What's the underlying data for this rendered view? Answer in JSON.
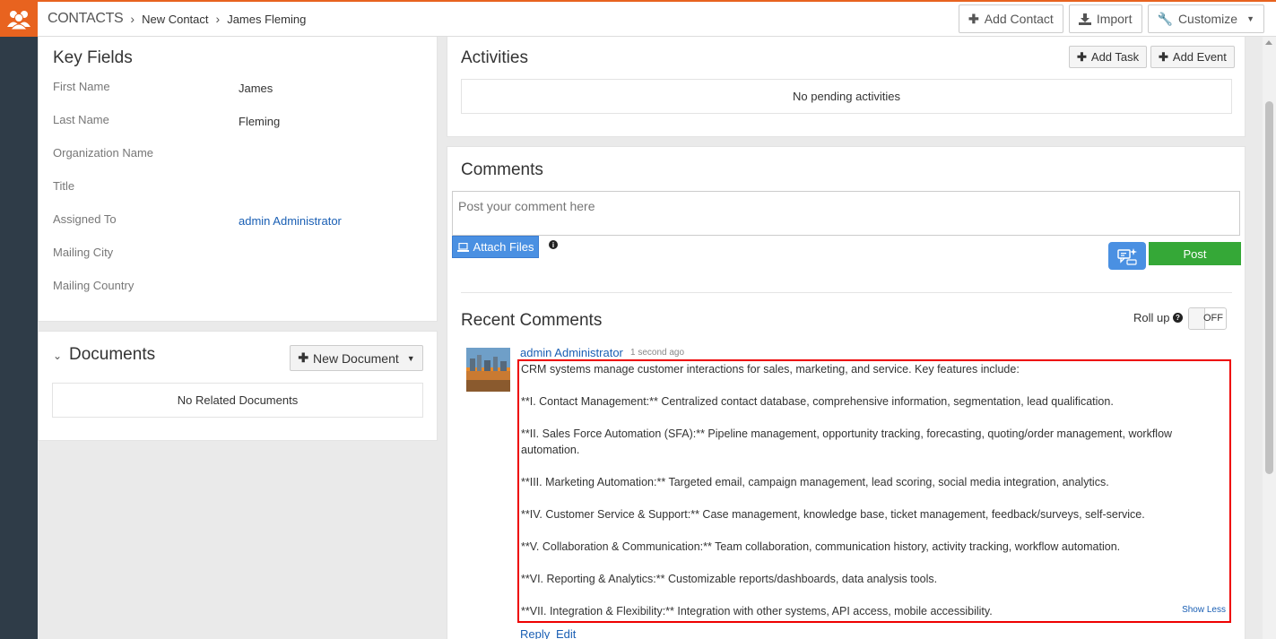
{
  "header": {
    "module": "CONTACTS",
    "breadcrumb_mid": "New Contact",
    "breadcrumb_current": "James Fleming",
    "add_contact_label": "Add Contact",
    "import_label": "Import",
    "customize_label": "Customize"
  },
  "key_fields": {
    "title": "Key Fields",
    "fields": [
      {
        "label": "First Name",
        "value": "James"
      },
      {
        "label": "Last Name",
        "value": "Fleming"
      },
      {
        "label": "Organization Name",
        "value": ""
      },
      {
        "label": "Title",
        "value": ""
      },
      {
        "label": "Assigned To",
        "value": "admin Administrator"
      },
      {
        "label": "Mailing City",
        "value": ""
      },
      {
        "label": "Mailing Country",
        "value": ""
      }
    ]
  },
  "documents": {
    "title": "Documents",
    "new_document_label": "New Document",
    "empty_text": "No Related Documents"
  },
  "activities": {
    "title": "Activities",
    "add_task_label": "Add Task",
    "add_event_label": "Add Event",
    "empty_text": "No pending activities"
  },
  "comments": {
    "title": "Comments",
    "placeholder": "Post your comment here",
    "attach_label": "Attach Files",
    "post_label": "Post",
    "recent_title": "Recent Comments",
    "rollup_label": "Roll up",
    "toggle_text": "OFF",
    "items": [
      {
        "author": "admin Administrator",
        "time": "1 second ago",
        "lines": [
          "CRM systems manage customer interactions for sales, marketing, and service. Key features include:",
          "**I. Contact Management:** Centralized contact database, comprehensive information, segmentation, lead qualification.",
          "**II. Sales Force Automation (SFA):** Pipeline management, opportunity tracking, forecasting, quoting/order management, workflow automation.",
          "**III. Marketing Automation:** Targeted email, campaign management, lead scoring, social media integration, analytics.",
          "**IV. Customer Service & Support:** Case management, knowledge base, ticket management, feedback/surveys, self-service.",
          "**V. Collaboration & Communication:** Team collaboration, communication history, activity tracking, workflow automation.",
          "**VI. Reporting & Analytics:** Customizable reports/dashboards, data analysis tools.",
          "**VII. Integration & Flexibility:** Integration with other systems, API access, mobile accessibility."
        ],
        "show_less_label": "Show Less",
        "reply_label": "Reply",
        "edit_label": "Edit"
      }
    ]
  },
  "colors": {
    "brand": "#e8631f",
    "nav": "#2f3c48",
    "link": "#1a5fb4",
    "primary_button": "#4a90e2",
    "post_button": "#35a837",
    "highlight": "#e00000"
  }
}
